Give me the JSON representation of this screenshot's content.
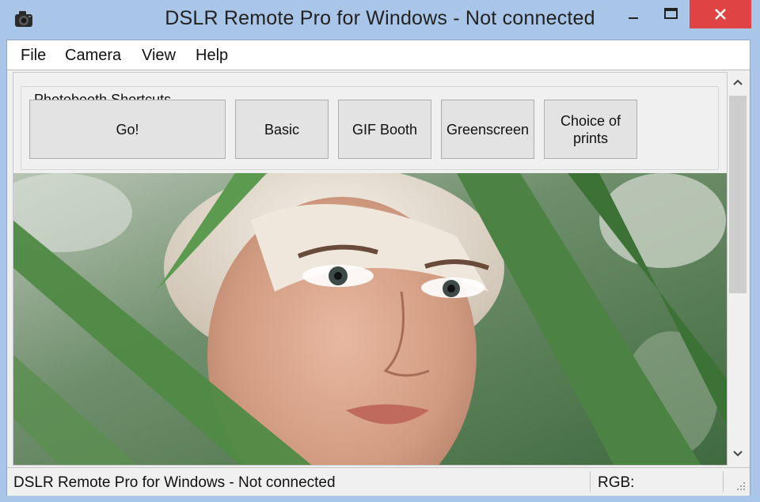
{
  "window": {
    "title": "DSLR Remote Pro for Windows - Not connected"
  },
  "menu": {
    "items": [
      "File",
      "Camera",
      "View",
      "Help"
    ]
  },
  "photobooth": {
    "group_label": "Photobooth Shortcuts",
    "buttons": [
      "Go!",
      "Basic",
      "GIF Booth",
      "Greenscreen",
      "Choice of prints"
    ]
  },
  "status": {
    "text": "DSLR Remote Pro for Windows - Not connected",
    "rgb_label": "RGB:"
  },
  "colors": {
    "titlebar": "#a9c6e8",
    "close_button": "#e04343"
  },
  "icons": {
    "app": "camera-icon",
    "minimize": "minimize-icon",
    "maximize": "maximize-icon",
    "close": "close-icon"
  }
}
